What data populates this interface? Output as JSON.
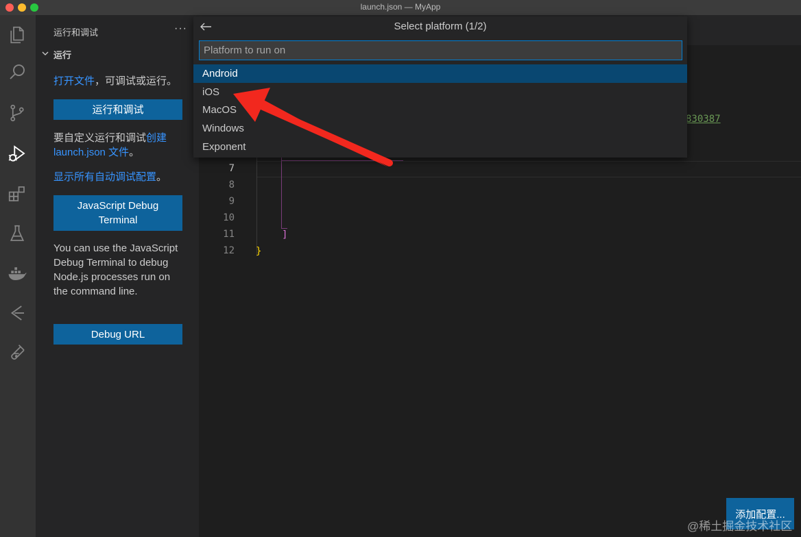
{
  "window": {
    "title": "launch.json — MyApp"
  },
  "activity_bar": {
    "icons": [
      "files-icon",
      "search-icon",
      "source-control-icon",
      "run-debug-icon",
      "extensions-icon",
      "testing-icon",
      "docker-icon",
      "git-graph-icon",
      "flask-icon"
    ]
  },
  "sidebar": {
    "title": "运行和调试",
    "more": "···",
    "section": "运行",
    "open_file_link": "打开文件",
    "open_file_rest": "，可调试或运行。",
    "run_debug_button": "运行和调试",
    "customize_text": "要自定义运行和调试",
    "create_link": "创建",
    "launch_link": "launch.json 文件",
    "period": "。",
    "show_all_link": "显示所有自动调试配置",
    "show_all_period": "。",
    "js_terminal_button": "JavaScript Debug Terminal",
    "js_terminal_desc": "You can use the JavaScript Debug Terminal to debug Node.js processes run on the command line.",
    "debug_url_button": "Debug URL"
  },
  "editor": {
    "line_numbers": [
      "7",
      "8",
      "9",
      "10",
      "11",
      "12"
    ],
    "active_line": "7",
    "code_bracket": "]",
    "code_brace": "}",
    "partial_number": "830387",
    "add_config_button": "添加配置..."
  },
  "quick_pick": {
    "title": "Select platform (1/2)",
    "placeholder": "Platform to run on",
    "items": [
      "Android",
      "iOS",
      "MacOS",
      "Windows",
      "Exponent"
    ],
    "selected": "Android"
  },
  "watermark": "@稀土掘金技术社区",
  "colors": {
    "accent": "#0e639c",
    "selection": "#094771",
    "link": "#3794ff",
    "arrow": "#f2281e"
  }
}
